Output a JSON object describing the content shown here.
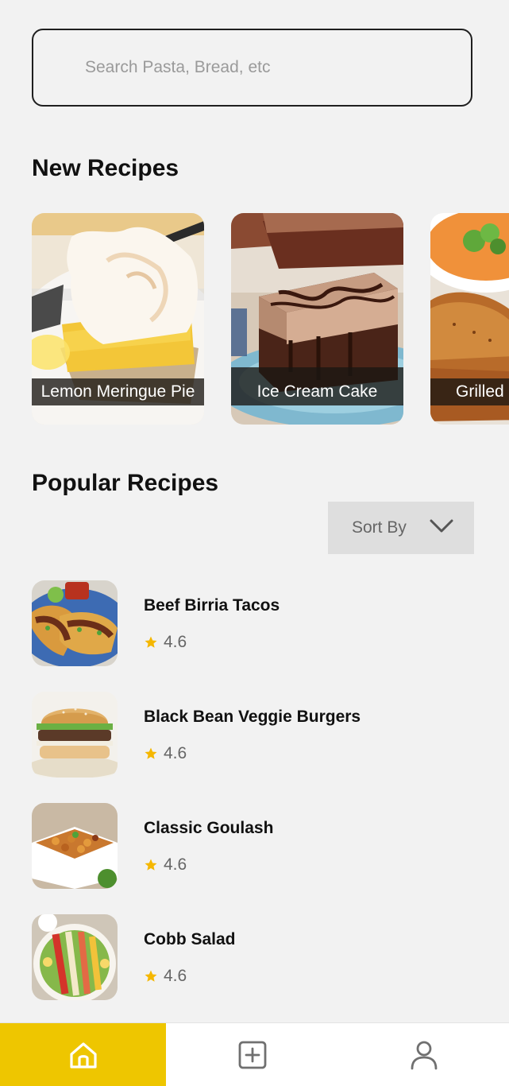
{
  "search": {
    "placeholder": "Search Pasta, Bread, etc",
    "value": ""
  },
  "new_recipes": {
    "title": "New Recipes",
    "items": [
      {
        "label": "Lemon Meringue Pie"
      },
      {
        "label": "Ice Cream Cake"
      },
      {
        "label": "Grilled Sand"
      }
    ]
  },
  "popular": {
    "title": "Popular Recipes",
    "sort_label": "Sort By",
    "items": [
      {
        "name": "Beef Birria Tacos",
        "rating": "4.6"
      },
      {
        "name": "Black Bean Veggie Burgers",
        "rating": "4.6"
      },
      {
        "name": "Classic Goulash",
        "rating": "4.6"
      },
      {
        "name": "Cobb Salad",
        "rating": "4.6"
      }
    ]
  },
  "nav": {
    "active": "home",
    "items": [
      "home-icon",
      "add-box-icon",
      "user-icon"
    ]
  },
  "colors": {
    "accent": "#eec600",
    "star": "#f5b700",
    "background": "#f2f2f2"
  }
}
